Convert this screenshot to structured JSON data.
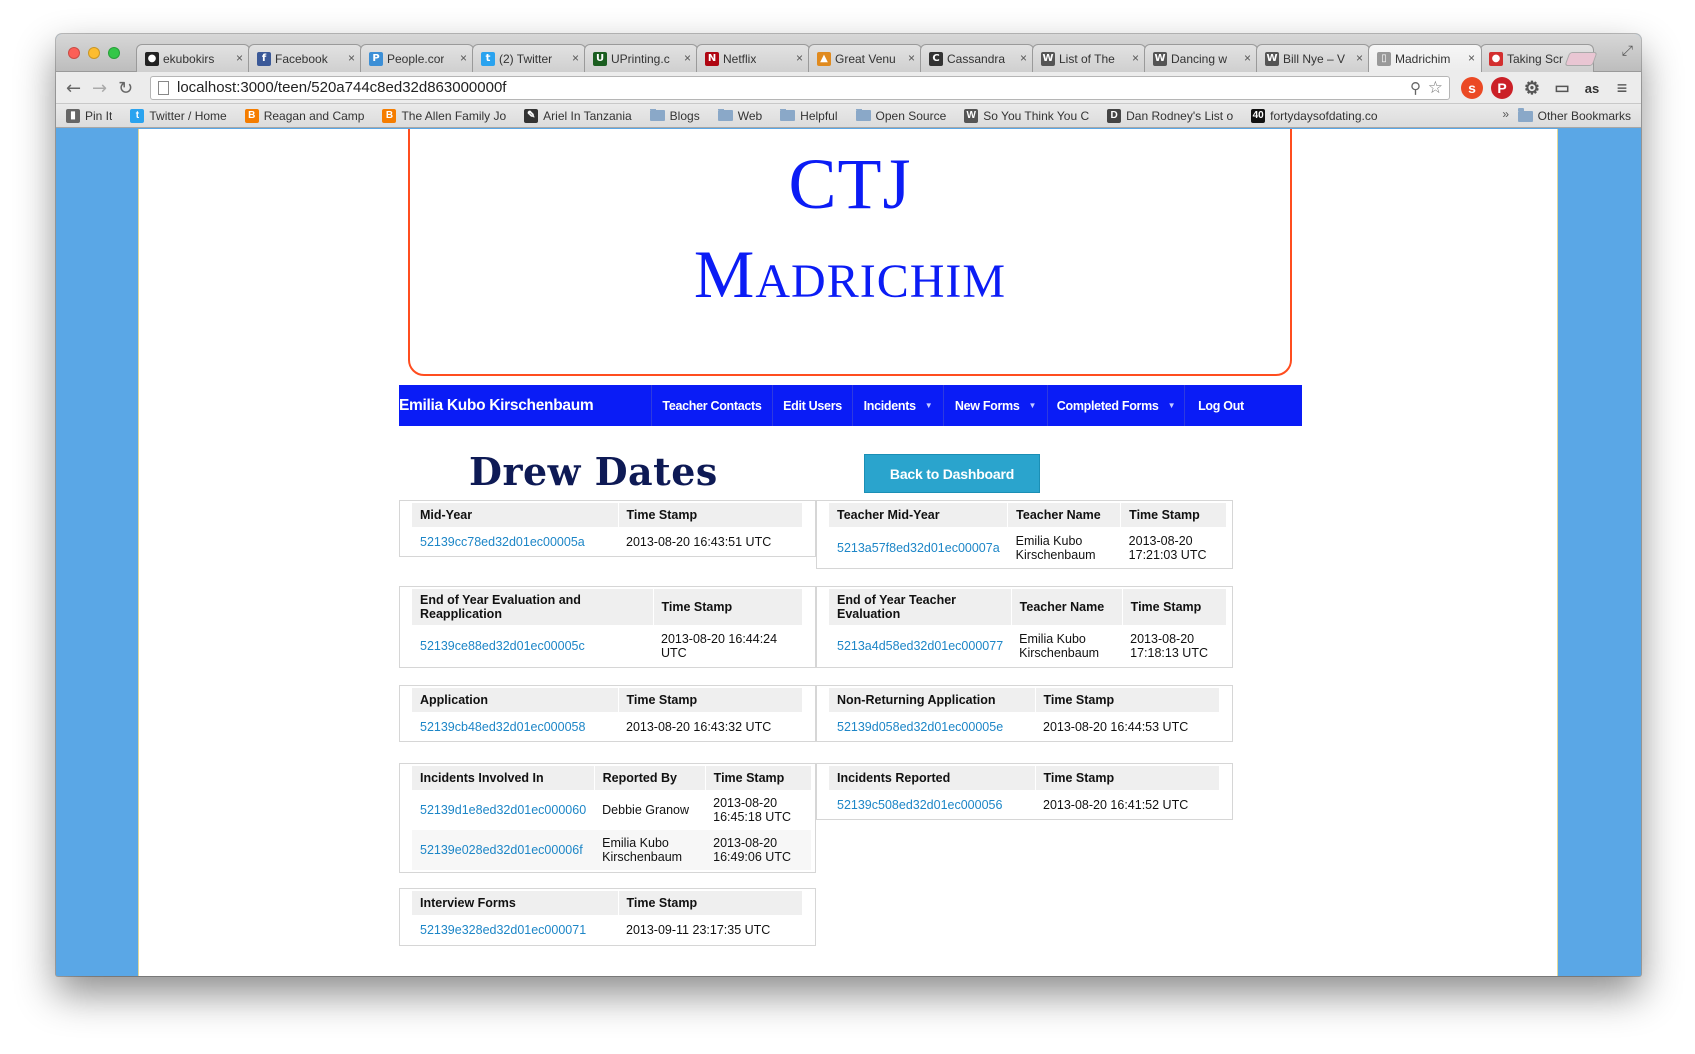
{
  "browser": {
    "tabs": [
      {
        "title": "ekubokirs",
        "icon": "github-icon",
        "color": "#222222",
        "glyph": "●"
      },
      {
        "title": "Facebook",
        "icon": "facebook-icon",
        "color": "#3b5998",
        "glyph": "f"
      },
      {
        "title": "People.cor",
        "icon": "people-icon",
        "color": "#3c8fd6",
        "glyph": "P"
      },
      {
        "title": "(2) Twitter",
        "icon": "twitter-icon",
        "color": "#2aa3ef",
        "glyph": "t"
      },
      {
        "title": "UPrinting.c",
        "icon": "uprinting-icon",
        "color": "#1b5e20",
        "glyph": "U"
      },
      {
        "title": "Netflix",
        "icon": "netflix-icon",
        "color": "#b00612",
        "glyph": "N"
      },
      {
        "title": "Great Venu",
        "icon": "chart-icon",
        "color": "#e08a1e",
        "glyph": "▲"
      },
      {
        "title": "Cassandra",
        "icon": "cassandra-icon",
        "color": "#333333",
        "glyph": "C"
      },
      {
        "title": "List of The",
        "icon": "wikipedia-icon",
        "color": "#555555",
        "glyph": "W"
      },
      {
        "title": "Dancing w",
        "icon": "wikipedia-icon",
        "color": "#555555",
        "glyph": "W"
      },
      {
        "title": "Bill Nye – V",
        "icon": "wikipedia-icon",
        "color": "#555555",
        "glyph": "W"
      },
      {
        "title": "Madrichim",
        "icon": "page-icon",
        "color": "#999999",
        "glyph": "▯"
      },
      {
        "title": "Taking Scr",
        "icon": "taking-icon",
        "color": "#d32f2f",
        "glyph": "●"
      }
    ],
    "url": "localhost:3000/teen/520a744c8ed32d863000000f",
    "bookmarks": [
      {
        "label": "Pin It",
        "icon": "pin-icon",
        "color": "#666666",
        "glyph": "▮"
      },
      {
        "label": "Twitter / Home",
        "icon": "twitter-icon",
        "color": "#2aa3ef",
        "glyph": "t"
      },
      {
        "label": "Reagan and Camp",
        "icon": "blogger-icon",
        "color": "#f57d00",
        "glyph": "B"
      },
      {
        "label": "The Allen Family Jo",
        "icon": "blogger-icon",
        "color": "#f57d00",
        "glyph": "B"
      },
      {
        "label": "Ariel In Tanzania",
        "icon": "ariel-icon",
        "color": "#333333",
        "glyph": "✎"
      },
      {
        "label": "Blogs",
        "icon": "folder-icon",
        "color": "",
        "glyph": ""
      },
      {
        "label": "Web",
        "icon": "folder-icon",
        "color": "",
        "glyph": ""
      },
      {
        "label": "Helpful",
        "icon": "folder-icon",
        "color": "",
        "glyph": ""
      },
      {
        "label": "Open Source",
        "icon": "folder-icon",
        "color": "",
        "glyph": ""
      },
      {
        "label": "So You Think You C",
        "icon": "wikipedia-icon",
        "color": "#555555",
        "glyph": "W"
      },
      {
        "label": "Dan Rodney's List o",
        "icon": "dr-icon",
        "color": "#444444",
        "glyph": "D"
      },
      {
        "label": "fortydaysofdating.co",
        "icon": "forty-icon",
        "color": "#111111",
        "glyph": "40"
      }
    ],
    "other_bookmarks": "Other Bookmarks"
  },
  "site": {
    "title_line1": "CTJ",
    "title_line2": "Madrichim",
    "nav": {
      "brand": "Emilia Kubo Kirschenbaum",
      "items": [
        "Teacher Contacts",
        "Edit Users",
        "Incidents",
        "New Forms",
        "Completed Forms",
        "Log Out"
      ]
    },
    "page_heading": "Drew Dates",
    "back_button": "Back to Dashboard"
  },
  "tables": {
    "mid_year": {
      "headers": [
        "Mid-Year",
        "Time Stamp"
      ],
      "rows": [
        [
          "52139cc78ed32d01ec00005a",
          "2013-08-20 16:43:51 UTC"
        ]
      ]
    },
    "teacher_mid_year": {
      "headers": [
        "Teacher Mid-Year",
        "Teacher Name",
        "Time Stamp"
      ],
      "rows": [
        [
          "5213a57f8ed32d01ec00007a",
          "Emilia Kubo Kirschenbaum",
          "2013-08-20 17:21:03 UTC"
        ]
      ]
    },
    "end_of_year": {
      "headers": [
        "End of Year Evaluation and Reapplication",
        "Time Stamp"
      ],
      "rows": [
        [
          "52139ce88ed32d01ec00005c",
          "2013-08-20 16:44:24 UTC"
        ]
      ]
    },
    "end_of_year_teacher": {
      "headers": [
        "End of Year Teacher Evaluation",
        "Teacher Name",
        "Time Stamp"
      ],
      "rows": [
        [
          "5213a4d58ed32d01ec000077",
          "Emilia Kubo Kirschenbaum",
          "2013-08-20 17:18:13 UTC"
        ]
      ]
    },
    "application": {
      "headers": [
        "Application",
        "Time Stamp"
      ],
      "rows": [
        [
          "52139cb48ed32d01ec000058",
          "2013-08-20 16:43:32 UTC"
        ]
      ]
    },
    "non_returning": {
      "headers": [
        "Non-Returning Application",
        "Time Stamp"
      ],
      "rows": [
        [
          "52139d058ed32d01ec00005e",
          "2013-08-20 16:44:53 UTC"
        ]
      ]
    },
    "incidents_involved": {
      "headers": [
        "Incidents Involved In",
        "Reported By",
        "Time Stamp"
      ],
      "rows": [
        [
          "52139d1e8ed32d01ec000060",
          "Debbie Granow",
          "2013-08-20 16:45:18 UTC"
        ],
        [
          "52139e028ed32d01ec00006f",
          "Emilia Kubo Kirschenbaum",
          "2013-08-20 16:49:06 UTC"
        ]
      ]
    },
    "incidents_reported": {
      "headers": [
        "Incidents Reported",
        "Time Stamp"
      ],
      "rows": [
        [
          "52139c508ed32d01ec000056",
          "2013-08-20 16:41:52 UTC"
        ]
      ]
    },
    "interview_forms": {
      "headers": [
        "Interview Forms",
        "Time Stamp"
      ],
      "rows": [
        [
          "52139e328ed32d01ec000071",
          "2013-09-11 23:17:35 UTC"
        ]
      ]
    }
  },
  "colors": {
    "nav_bg": "#0a1cf6",
    "title": "#0b1cf5",
    "banner_border": "#ff4d1f",
    "link": "#1d86c7",
    "button": "#2aa4cd",
    "heading": "#0e1a55"
  }
}
